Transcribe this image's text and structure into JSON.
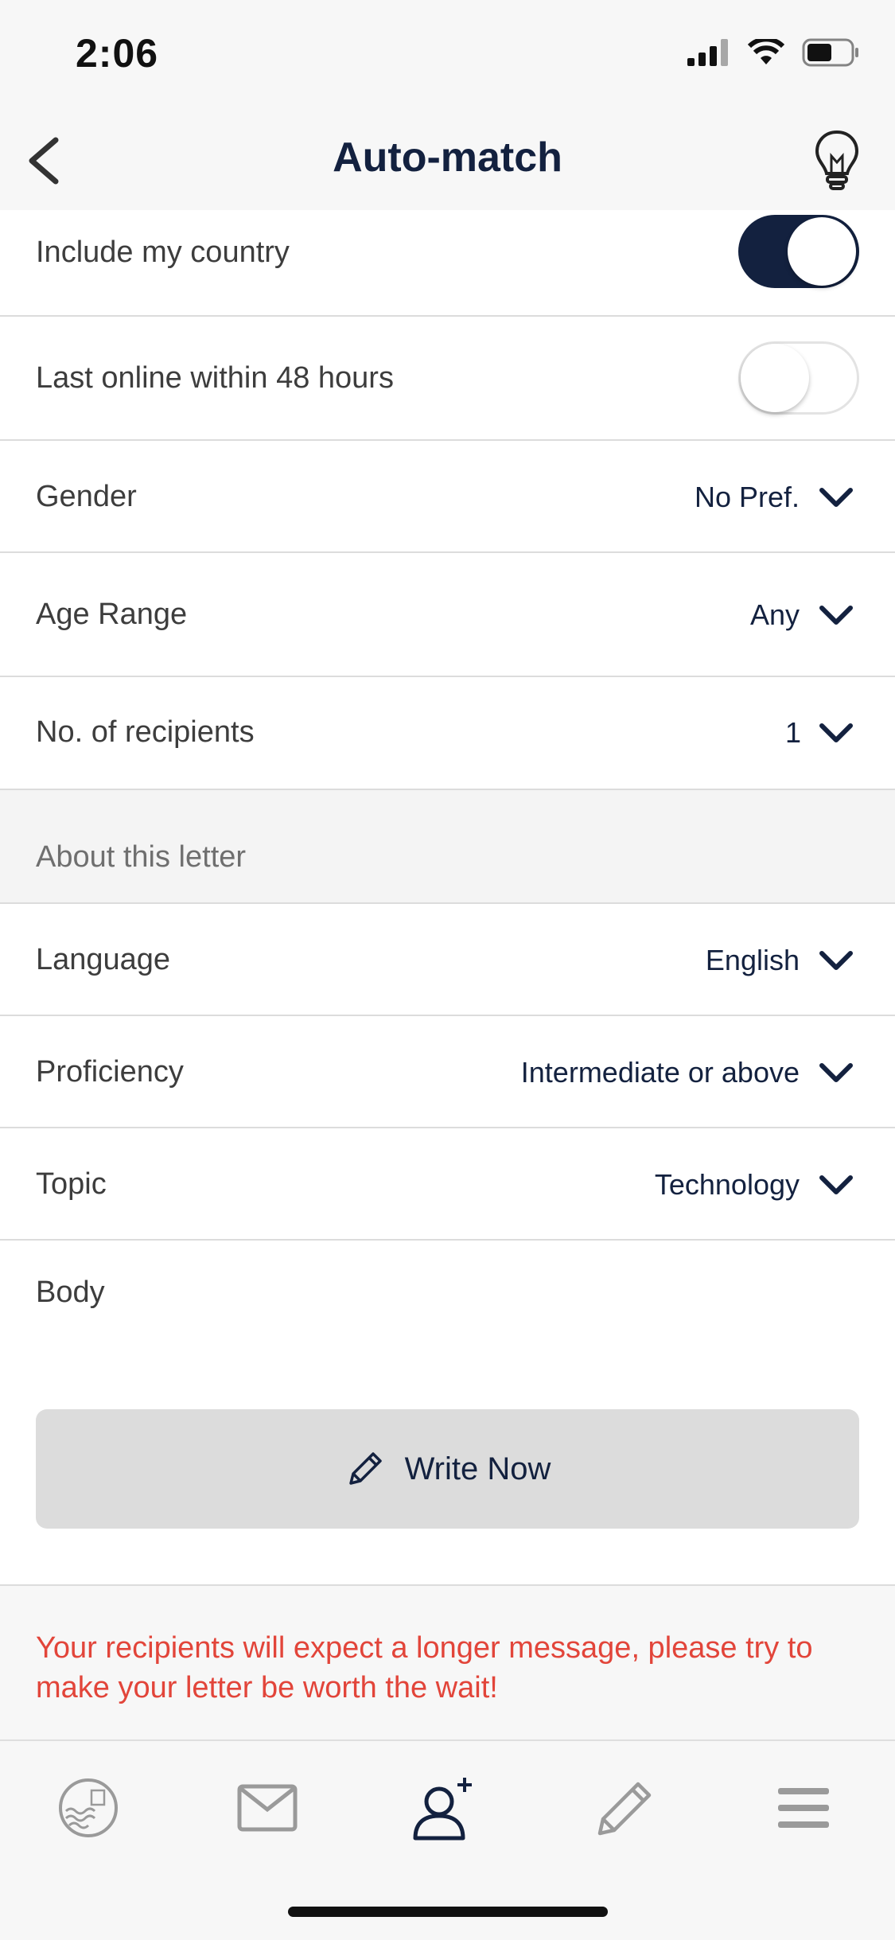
{
  "status": {
    "time": "2:06"
  },
  "nav": {
    "title": "Auto-match"
  },
  "settings": [
    {
      "label": "Include my country",
      "type": "toggle",
      "on": true
    },
    {
      "label": "Last online within 48 hours",
      "type": "toggle",
      "on": false
    },
    {
      "label": "Gender",
      "type": "select",
      "value": "No Pref."
    },
    {
      "label": "Age Range",
      "type": "select",
      "value": "Any"
    },
    {
      "label": "No. of recipients",
      "type": "select",
      "value": "1"
    }
  ],
  "letter_section": {
    "header": "About this letter",
    "rows": [
      {
        "label": "Language",
        "value": "English"
      },
      {
        "label": "Proficiency",
        "value": "Intermediate or above"
      },
      {
        "label": "Topic",
        "value": "Technology"
      }
    ],
    "body_label": "Body",
    "write_button": "Write Now"
  },
  "warning": "Your recipients will expect a longer message, please try to make your letter be worth the wait!",
  "tabs": [
    {
      "icon": "stamp-icon",
      "active": false
    },
    {
      "icon": "mail-icon",
      "active": false
    },
    {
      "icon": "add-friend-icon",
      "active": true
    },
    {
      "icon": "pencil-icon",
      "active": false
    },
    {
      "icon": "menu-icon",
      "active": false
    }
  ],
  "colors": {
    "accent": "#13213f",
    "warning": "#e2453a",
    "inactive_icon": "#9a9a9a"
  }
}
